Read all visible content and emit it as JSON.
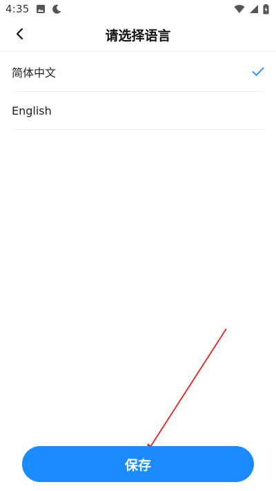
{
  "status_bar": {
    "time": "4:35",
    "icons_left": [
      "image-icon",
      "moon-icon"
    ],
    "icons_right": [
      "wifi-icon",
      "signal-icon",
      "battery-charging-icon"
    ]
  },
  "header": {
    "title": "请选择语言",
    "back_icon": "chevron-left-icon"
  },
  "languages": [
    {
      "label": "简体中文",
      "selected": true
    },
    {
      "label": "English",
      "selected": false
    }
  ],
  "colors": {
    "accent": "#1a8cff",
    "check": "#1a8cff",
    "annotation": "#e03030"
  },
  "save_button": {
    "label": "保存"
  }
}
